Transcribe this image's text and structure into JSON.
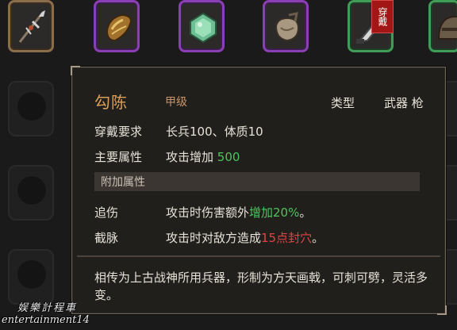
{
  "inventory": {
    "slots": [
      {
        "icon": "spear-icon",
        "rarity": "bronze"
      },
      {
        "icon": "armor-icon",
        "rarity": "purple"
      },
      {
        "icon": "jade-icon",
        "rarity": "purple"
      },
      {
        "icon": "bag-icon",
        "rarity": "purple"
      },
      {
        "icon": "saber-icon",
        "rarity": "green",
        "equipped_label": "穿戴"
      },
      {
        "icon": "helmet-icon",
        "rarity": "green"
      }
    ]
  },
  "tooltip": {
    "name": "勾陈",
    "grade": "甲级",
    "type_label": "类型",
    "type_value": "武器 枪",
    "requirement_label": "穿戴要求",
    "requirement_value": "长兵100、体质10",
    "main_attr_label": "主要属性",
    "main_attr_text": "攻击增加",
    "main_attr_number": "500",
    "extra_section_label": "附加属性",
    "extras": [
      {
        "name": "追伤",
        "text": "攻击时伤害额外",
        "highlight": "增加20%",
        "suffix": "。",
        "highlight_color": "#4ec45e"
      },
      {
        "name": "截脉",
        "text": "攻击时对敌方造成",
        "highlight": "15点封穴",
        "suffix": "。",
        "highlight_color": "#e04545"
      }
    ],
    "description": "相传为上古战神所用兵器，形制为方天画戟，可刺可劈，灵活多变。"
  },
  "watermark": {
    "line1": "娱樂計程車",
    "line2": "entertainment14"
  }
}
